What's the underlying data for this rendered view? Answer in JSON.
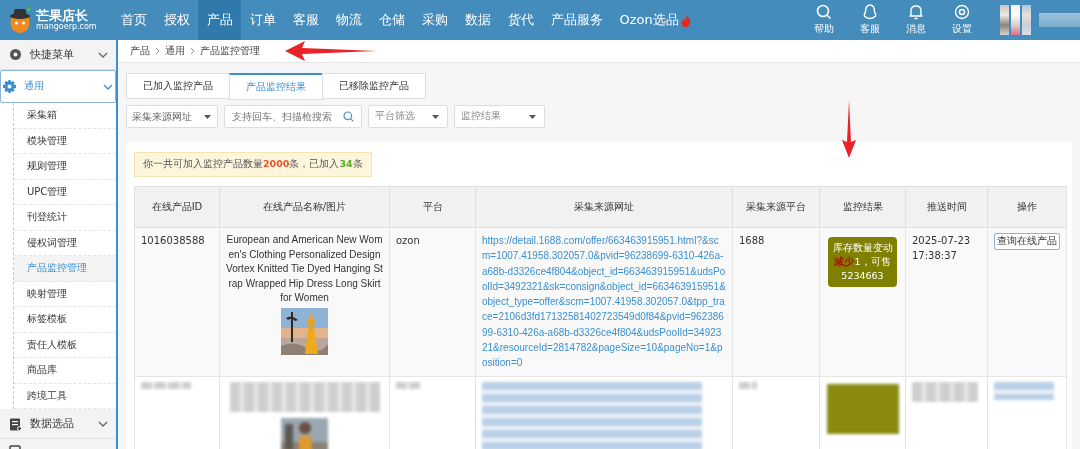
{
  "header": {
    "logo": {
      "name": "芒果店长",
      "domain": "mangoerp.com"
    },
    "nav": [
      {
        "label": "首页",
        "selected": false,
        "hot": false
      },
      {
        "label": "授权",
        "selected": false,
        "hot": false
      },
      {
        "label": "产品",
        "selected": true,
        "hot": false
      },
      {
        "label": "订单",
        "selected": false,
        "hot": false
      },
      {
        "label": "客服",
        "selected": false,
        "hot": false
      },
      {
        "label": "物流",
        "selected": false,
        "hot": false
      },
      {
        "label": "仓储",
        "selected": false,
        "hot": false
      },
      {
        "label": "采购",
        "selected": false,
        "hot": false
      },
      {
        "label": "数据",
        "selected": false,
        "hot": false
      },
      {
        "label": "货代",
        "selected": false,
        "hot": false
      },
      {
        "label": "产品服务",
        "selected": false,
        "hot": false
      },
      {
        "label": "Ozon选品",
        "selected": false,
        "hot": true
      }
    ],
    "tools": [
      {
        "kind": "search",
        "label": "帮助"
      },
      {
        "kind": "penguin",
        "label": "客服"
      },
      {
        "kind": "bell",
        "label": "消息"
      },
      {
        "kind": "gear",
        "label": "设置"
      }
    ]
  },
  "sidebar": {
    "groups": [
      {
        "kind": "gear",
        "label": "快捷菜单",
        "expanded": false,
        "active": false
      },
      {
        "kind": "cog",
        "label": "通用",
        "expanded": true,
        "active": true,
        "children": [
          {
            "label": "采集箱",
            "selected": false
          },
          {
            "label": "模块管理",
            "selected": false
          },
          {
            "label": "规则管理",
            "selected": false
          },
          {
            "label": "UPC管理",
            "selected": false
          },
          {
            "label": "刊登统计",
            "selected": false
          },
          {
            "label": "侵权词管理",
            "selected": false
          },
          {
            "label": "产品监控管理",
            "selected": true
          },
          {
            "label": "映射管理",
            "selected": false
          },
          {
            "label": "标签模板",
            "selected": false
          },
          {
            "label": "责任人模板",
            "selected": false
          },
          {
            "label": "商品库",
            "selected": false
          },
          {
            "label": "跨境工具",
            "selected": false
          }
        ]
      },
      {
        "kind": "clipboard",
        "label": "数据选品",
        "expanded": false,
        "active": false
      }
    ]
  },
  "breadcrumb": [
    "产品",
    "通用",
    "产品监控管理"
  ],
  "tabs": [
    {
      "label": "已加入监控产品",
      "selected": false
    },
    {
      "label": "产品监控结果",
      "selected": true
    },
    {
      "label": "已移除监控产品",
      "selected": false
    }
  ],
  "filters": [
    {
      "kind": "dropdown",
      "value": "采集来源网址"
    },
    {
      "kind": "search",
      "placeholder": "支持回车、扫描枪搜索"
    },
    {
      "kind": "dropdown",
      "placeholder": "平台筛选"
    },
    {
      "kind": "dropdown",
      "placeholder": "监控结果"
    }
  ],
  "notice": [
    {
      "text": "你一共可加入监控产品数量"
    },
    {
      "text": "2000",
      "color": "#e8542a"
    },
    {
      "text": "条，已加入"
    },
    {
      "text": "34",
      "color": "#5aab2e"
    },
    {
      "text": "条"
    }
  ],
  "table": {
    "columns": [
      "在线产品ID",
      "在线产品名称/图片",
      "平台",
      "采集来源网址",
      "采集来源平台",
      "监控结果",
      "推送时间",
      "操作"
    ],
    "rows": [
      {
        "kind": "data",
        "id": "1016038588",
        "name": "European and American New Women's Clothing Personalized Design Vortex Knitted Tie Dyed Hanging Strap Wrapped Hip Dress Long Skirt for Women",
        "image": {
          "kind": "picture"
        },
        "platform": "ozon",
        "url": "https://detail.1688.com/offer/663463915951.html?&scm=1007.41958.302057.0&pvid=96238699-6310-426a-a68b-d3326ce4f804&object_id=663463915951&udsPoolId=3492321&sk=consign&object_id=663463915951&object_type=offer&scm=1007.41958.302057.0&tpp_trace=2106d3fd17132581402723549d0f84&pvid=96238699-6310-426a-a68b-d3326ce4f804&udsPoolId=3492321&resourceId=2814782&pageSize=10&pageNo=1&position=0",
        "source_platform": "1688",
        "result": [
          {
            "text": "库存数量变动"
          },
          {
            "text": "减少",
            "color": "#b01010"
          },
          {
            "text": "1，可售5234663"
          }
        ],
        "push_time": "2025-07-23 17:38:37",
        "action": "查询在线产品"
      },
      {
        "kind": "redacted",
        "image": {
          "kind": "picture"
        }
      }
    ]
  },
  "annotation_arrows": [
    {
      "kind": "left"
    },
    {
      "kind": "down"
    }
  ]
}
